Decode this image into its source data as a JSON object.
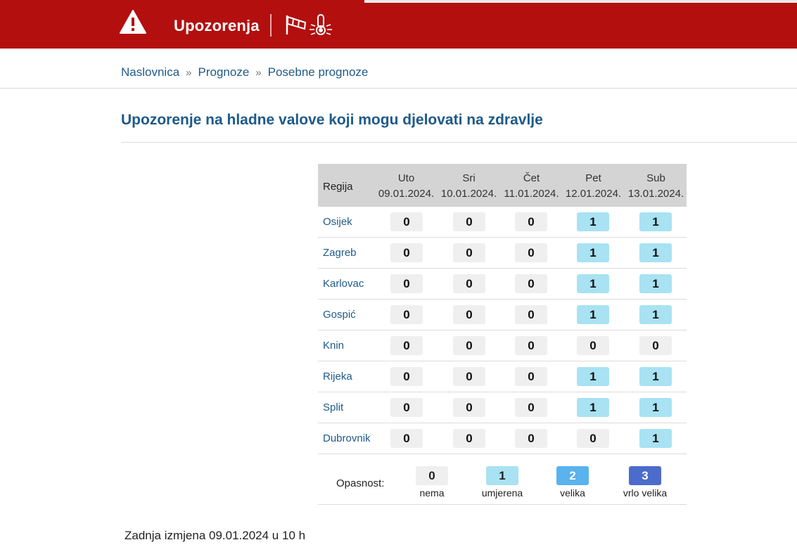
{
  "header": {
    "title": "Upozorenja",
    "bg_color": "#b30f0f",
    "icons": [
      "warning-triangle-icon",
      "windsock-icon",
      "thermometer-icon"
    ]
  },
  "breadcrumb": {
    "items": [
      "Naslovnica",
      "Prognoze",
      "Posebne prognoze"
    ],
    "separator": "»"
  },
  "page_title": "Upozorenje na hladne valove koji mogu djelovati na zdravlje",
  "table": {
    "region_header": "Regija",
    "days": [
      {
        "day": "Uto",
        "date": "09.01.2024."
      },
      {
        "day": "Sri",
        "date": "10.01.2024."
      },
      {
        "day": "Čet",
        "date": "11.01.2024."
      },
      {
        "day": "Pet",
        "date": "12.01.2024."
      },
      {
        "day": "Sub",
        "date": "13.01.2024."
      }
    ],
    "rows": [
      {
        "region": "Osijek",
        "values": [
          0,
          0,
          0,
          1,
          1
        ]
      },
      {
        "region": "Zagreb",
        "values": [
          0,
          0,
          0,
          1,
          1
        ]
      },
      {
        "region": "Karlovac",
        "values": [
          0,
          0,
          0,
          1,
          1
        ]
      },
      {
        "region": "Gospić",
        "values": [
          0,
          0,
          0,
          1,
          1
        ]
      },
      {
        "region": "Knin",
        "values": [
          0,
          0,
          0,
          0,
          0
        ]
      },
      {
        "region": "Rijeka",
        "values": [
          0,
          0,
          0,
          1,
          1
        ]
      },
      {
        "region": "Split",
        "values": [
          0,
          0,
          0,
          1,
          1
        ]
      },
      {
        "region": "Dubrovnik",
        "values": [
          0,
          0,
          0,
          0,
          1
        ]
      }
    ]
  },
  "legend": {
    "label": "Opasnost:",
    "items": [
      {
        "value": "0",
        "text": "nema",
        "color": "#efefef"
      },
      {
        "value": "1",
        "text": "umjerena",
        "color": "#a8e2f3"
      },
      {
        "value": "2",
        "text": "velika",
        "color": "#5ab2ee"
      },
      {
        "value": "3",
        "text": "vrlo velika",
        "color": "#4c6ccc"
      }
    ]
  },
  "footer": "Zadnja izmjena 09.01.2024 u 10 h"
}
